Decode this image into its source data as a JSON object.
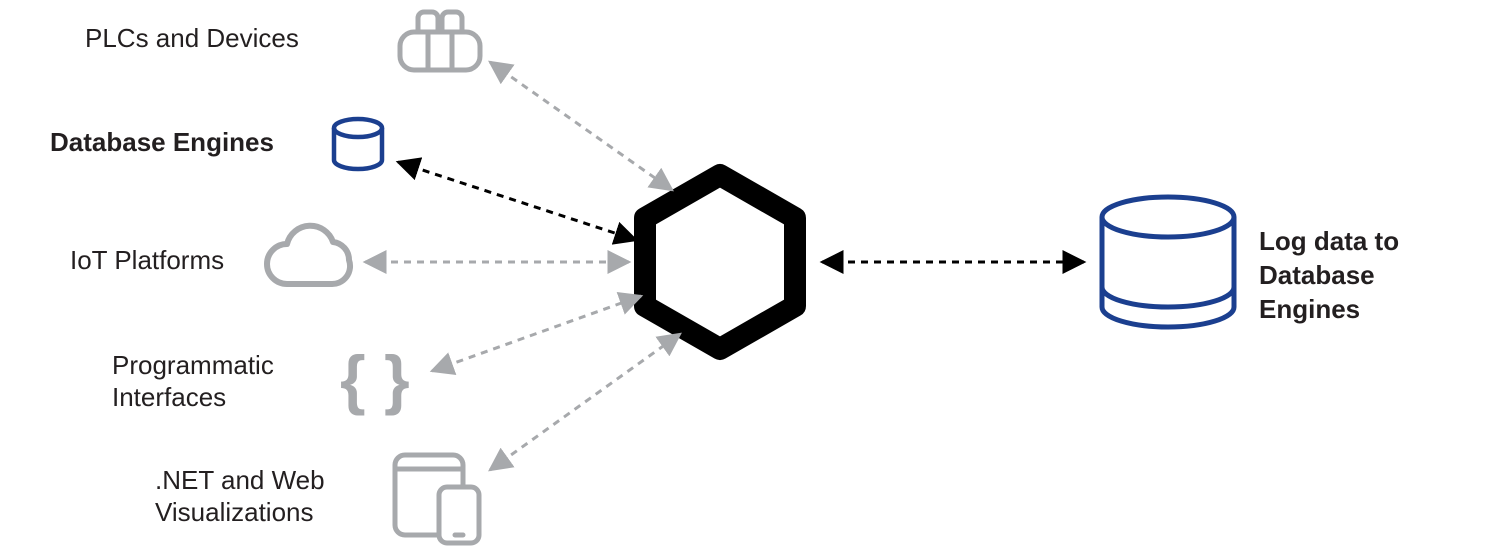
{
  "left_nodes": [
    {
      "label": "PLCs and Devices",
      "bold": false
    },
    {
      "label": "Database Engines",
      "bold": true
    },
    {
      "label": "IoT Platforms",
      "bold": false
    },
    {
      "label": "Programmatic",
      "label2": "Interfaces",
      "bold": false
    },
    {
      "label": ".NET and Web",
      "label2": "Visualizations",
      "bold": false
    }
  ],
  "right_node": {
    "line1": "Log data to",
    "line2": "Database",
    "line3": "Engines"
  },
  "colors": {
    "grey": "#a7a9ac",
    "blue": "#1b3f8f",
    "black": "#000000",
    "text": "#231f20"
  }
}
